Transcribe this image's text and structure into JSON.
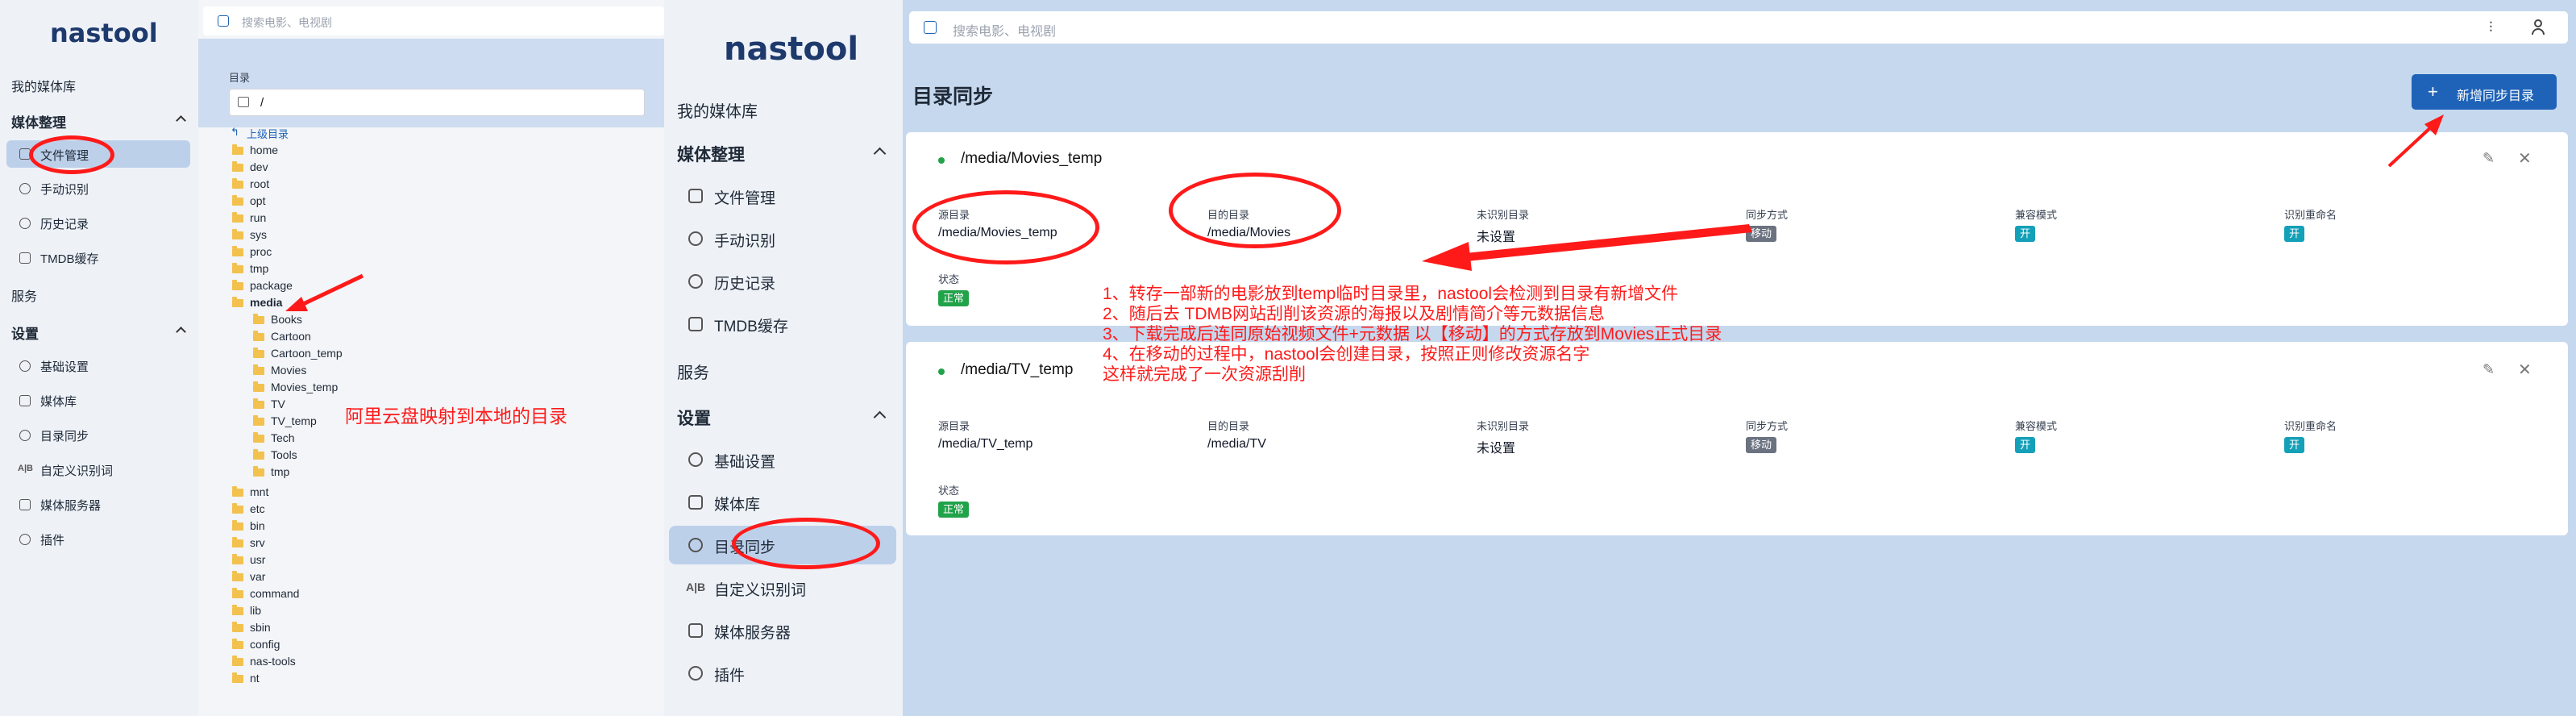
{
  "left_panel": {
    "logo": "nastool",
    "nav": {
      "library": "我的媒体库",
      "media_section": "媒体整理",
      "file_manage": "文件管理",
      "manual_identify": "手动识别",
      "history": "历史记录",
      "tmdb_cache": "TMDB缓存",
      "services": "服务",
      "settings_section": "设置",
      "basic_settings": "基础设置",
      "media_library": "媒体库",
      "dir_sync": "目录同步",
      "custom_words": "自定义识别词",
      "media_server": "媒体服务器",
      "plugins": "插件"
    }
  },
  "file_browser": {
    "search_placeholder": "搜索电影、电视剧",
    "dir_label": "目录",
    "path_value": "/",
    "parent_dir": "上级目录",
    "folders_top": [
      "home",
      "dev",
      "root",
      "opt",
      "run",
      "sys",
      "proc",
      "tmp",
      "package",
      "media"
    ],
    "media_children": [
      "Books",
      "Cartoon",
      "Cartoon_temp",
      "Movies",
      "Movies_temp",
      "TV",
      "TV_temp",
      "Tech",
      "Tools",
      "tmp"
    ],
    "folders_bottom": [
      "mnt",
      "etc",
      "bin",
      "srv",
      "usr",
      "var",
      "command",
      "lib",
      "sbin",
      "config",
      "nas-tools",
      "nt"
    ],
    "annotation": "阿里云盘映射到本地的目录"
  },
  "mid_panel": {
    "logo": "nastool",
    "nav": {
      "library": "我的媒体库",
      "media_section": "媒体整理",
      "file_manage": "文件管理",
      "manual_identify": "手动识别",
      "history": "历史记录",
      "tmdb_cache": "TMDB缓存",
      "services": "服务",
      "settings_section": "设置",
      "basic_settings": "基础设置",
      "media_library": "媒体库",
      "dir_sync": "目录同步",
      "custom_words": "自定义识别词",
      "media_server": "媒体服务器",
      "plugins": "插件"
    }
  },
  "main": {
    "search_placeholder": "搜索电影、电视剧",
    "page_title": "目录同步",
    "add_button": "新增同步目录",
    "columns": {
      "source": "源目录",
      "dest": "目的目录",
      "unknown": "未识别目录",
      "mode": "同步方式",
      "compat": "兼容模式",
      "rename": "识别重命名",
      "status": "状态"
    },
    "cards": [
      {
        "title": "/media/Movies_temp",
        "source": "/media/Movies_temp",
        "dest": "/media/Movies",
        "unknown": "未设置",
        "mode": "移动",
        "compat": "开",
        "rename": "开",
        "status": "正常"
      },
      {
        "title": "/media/TV_temp",
        "source": "/media/TV_temp",
        "dest": "/media/TV",
        "unknown": "未设置",
        "mode": "移动",
        "compat": "开",
        "rename": "开",
        "status": "正常"
      }
    ],
    "annotation_lines": [
      "1、转存一部新的电影放到temp临时目录里，nastool会检测到目录有新增文件",
      "2、随后去 TDMB网站刮削该资源的海报以及剧情简介等元数据信息",
      "3、下载完成后连同原始视频文件+元数据 以【移动】的方式存放到Movies正式目录",
      "4、在移动的过程中，nastool会创建目录，按照正则修改资源名字",
      "这样就完成了一次资源刮削"
    ]
  },
  "colors": {
    "accent": "#1f63b8",
    "annotation": "#ff1a1a",
    "badge_green": "#22a34a",
    "badge_gray": "#6b7280",
    "badge_teal": "#14a0b8"
  }
}
